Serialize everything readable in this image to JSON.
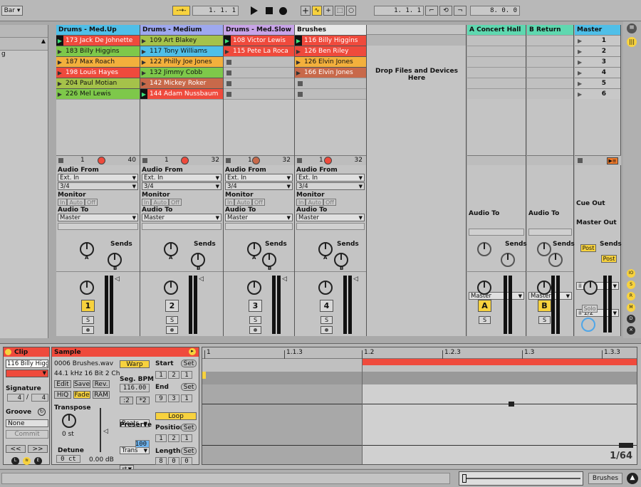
{
  "transport": {
    "quantize": "Bar",
    "arr_pos": "1.  1.  1",
    "punch_pos": "1.  1.  1",
    "loop_len": "8.  0.  0",
    "play_icon": "play-icon",
    "stop_icon": "stop-icon",
    "rec_icon": "record-icon"
  },
  "tracks": [
    {
      "name": "Drums - Med.Up",
      "color": "#4fbfe8",
      "clips": [
        {
          "label": "173 Jack De Johnette",
          "color": "#ef4a3c",
          "playing": true
        },
        {
          "label": "183 Billy Higgins",
          "color": "#7ec84a",
          "playing": false
        },
        {
          "label": "187 Max Roach",
          "color": "#f3b03c",
          "playing": false
        },
        {
          "label": "198 Louis Hayes",
          "color": "#ef4a3c",
          "playing": false
        },
        {
          "label": "204 Paul Motian",
          "color": "#a5c24a",
          "playing": false
        },
        {
          "label": "226 Mel Lewis",
          "color": "#7ec84a",
          "playing": false
        }
      ],
      "stat_a": "1",
      "stat_b": "40",
      "number": "1"
    },
    {
      "name": "Drums - Medium",
      "color": "#9ea8ef",
      "clips": [
        {
          "label": "109 Art Blakey",
          "color": "#a5c24a",
          "playing": false
        },
        {
          "label": "117 Tony Williams",
          "color": "#4fbfe8",
          "playing": false
        },
        {
          "label": "122 Philly Joe Jones",
          "color": "#f3b03c",
          "playing": false
        },
        {
          "label": "132 Jimmy Cobb",
          "color": "#7ec84a",
          "playing": false
        },
        {
          "label": "142 Mickey Roker",
          "color": "#c8694a",
          "playing": false
        },
        {
          "label": "144 Adam Nussbaum",
          "color": "#ef4a3c",
          "playing": true
        }
      ],
      "stat_a": "1",
      "stat_b": "32",
      "number": "2"
    },
    {
      "name": "Drums - Med.Slow",
      "color": "#c8a4e8",
      "clips": [
        {
          "label": "108 Victor Lewis",
          "color": "#ef4a3c",
          "playing": true
        },
        {
          "label": "115 Pete La Roca",
          "color": "#ef4a3c",
          "playing": false
        }
      ],
      "stat_a": "1",
      "stat_b": "32",
      "number": "3"
    },
    {
      "name": "Brushes",
      "color": "#e8e8e8",
      "clips": [
        {
          "label": "116 Billy Higgins",
          "color": "#ef4a3c",
          "playing": true
        },
        {
          "label": "126 Ben Riley",
          "color": "#ef4a3c",
          "playing": false
        },
        {
          "label": "126 Elvin Jones",
          "color": "#f3b03c",
          "playing": false
        },
        {
          "label": "166 Elvin Jones",
          "color": "#c8694a",
          "playing": false
        }
      ],
      "stat_a": "1",
      "stat_b": "32",
      "number": "4"
    }
  ],
  "io": {
    "audio_from": "Audio From",
    "ext_in": "Ext. In",
    "ch": "3/4",
    "monitor": "Monitor",
    "in": "In",
    "auto": "Auto",
    "off": "Off",
    "audio_to": "Audio To",
    "master": "Master",
    "sends": "Sends",
    "A": "A",
    "B": "B",
    "S": "S"
  },
  "drop_text": "Drop Files and Devices Here",
  "returns": [
    {
      "name": "A Concert Hall",
      "color": "#5fd8b0",
      "letter": "A"
    },
    {
      "name": "B Return",
      "color": "#5fd8b0",
      "letter": "B"
    }
  ],
  "master": {
    "name": "Master",
    "color": "#4fbfe8",
    "scenes": [
      "1",
      "2",
      "3",
      "4",
      "5",
      "6"
    ],
    "cue_out": "Cue Out",
    "cue_val": "ii 1/2",
    "master_out": "Master Out",
    "master_val": "ii 1/2",
    "post": "Post",
    "solo": "Solo"
  },
  "clip_panel": {
    "title": "Clip",
    "name": "116 Billy Higg",
    "signature": "Signature",
    "sig_num": "4",
    "sig_slash": "/",
    "sig_den": "4",
    "groove": "Groove",
    "groove_val": "None",
    "commit": "Commit"
  },
  "sample_panel": {
    "title": "Sample",
    "file": "0006 Brushes.wav",
    "info": "44.1 kHz 16 Bit 2 Ch",
    "edit": "Edit",
    "save": "Save",
    "rev": "Rev.",
    "hiq": "HiQ",
    "fade": "Fade",
    "ram": "RAM",
    "transpose": "Transpose",
    "transpose_val": "0 st",
    "detune": "Detune",
    "detune_val": "0 ct",
    "gain": "0.00 dB",
    "warp": "Warp",
    "seg_bpm": "Seg. BPM",
    "bpm": "116.00",
    "half": ":2",
    "dbl": "*2",
    "beats": "Beats",
    "preserve": "Preserve",
    "trans": "Trans",
    "grain": "100",
    "start": "Start",
    "set": "Set",
    "start_vals": [
      "1",
      "2",
      "1"
    ],
    "end": "End",
    "end_vals": [
      "9",
      "3",
      "1"
    ],
    "loop": "Loop",
    "position": "Position",
    "pos_vals": [
      "1",
      "2",
      "1"
    ],
    "length": "Length",
    "len_vals": [
      "8",
      "0",
      "0"
    ]
  },
  "timeline": {
    "markers": [
      "1",
      "1.1.3",
      "1.2",
      "1.2.3",
      "1.3",
      "1.3.3"
    ],
    "zoom": "1/64"
  },
  "status": {
    "track": "Brushes"
  }
}
